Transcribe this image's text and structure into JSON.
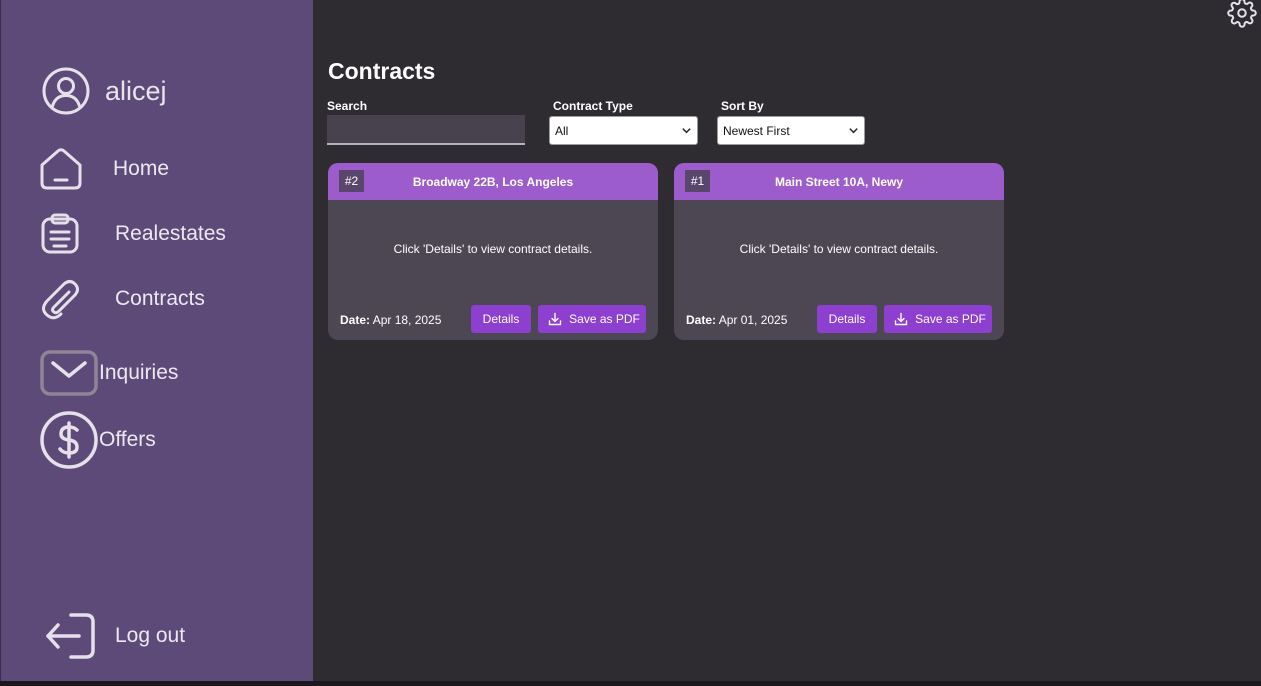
{
  "user": {
    "name": "alicej"
  },
  "nav": [
    {
      "id": "home",
      "label": "Home",
      "icon": "home-icon"
    },
    {
      "id": "realestates",
      "label": "Realestates",
      "icon": "clipboard-icon"
    },
    {
      "id": "contracts",
      "label": "Contracts",
      "icon": "paperclip-icon"
    },
    {
      "id": "inquiries",
      "label": "Inquiries",
      "icon": "mail-icon"
    },
    {
      "id": "offers",
      "label": "Offers",
      "icon": "dollar-circle-icon"
    }
  ],
  "logout": {
    "label": "Log out",
    "icon": "logout-icon"
  },
  "settings": {
    "icon": "gear-icon"
  },
  "page": {
    "title": "Contracts"
  },
  "filters": {
    "search_label": "Search",
    "search_value": "",
    "type_label": "Contract Type",
    "type_value": "All",
    "sort_label": "Sort By",
    "sort_value": "Newest First"
  },
  "cards": [
    {
      "id": "#2",
      "title": "Broadway 22B, Los Angeles",
      "message": "Click 'Details' to view contract details.",
      "date_label": "Date:",
      "date": "Apr 18, 2025",
      "details_label": "Details",
      "pdf_label": "Save as PDF"
    },
    {
      "id": "#1",
      "title": "Main Street 10A, Newy",
      "message": "Click 'Details' to view contract details.",
      "date_label": "Date:",
      "date": "Apr 01, 2025",
      "details_label": "Details",
      "pdf_label": "Save as PDF"
    }
  ],
  "colors": {
    "sidebar": "#5e4a78",
    "background": "#2e2b31",
    "card": "#4d4754",
    "card_header": "#9c5ccb",
    "button": "#8d3fd0"
  }
}
